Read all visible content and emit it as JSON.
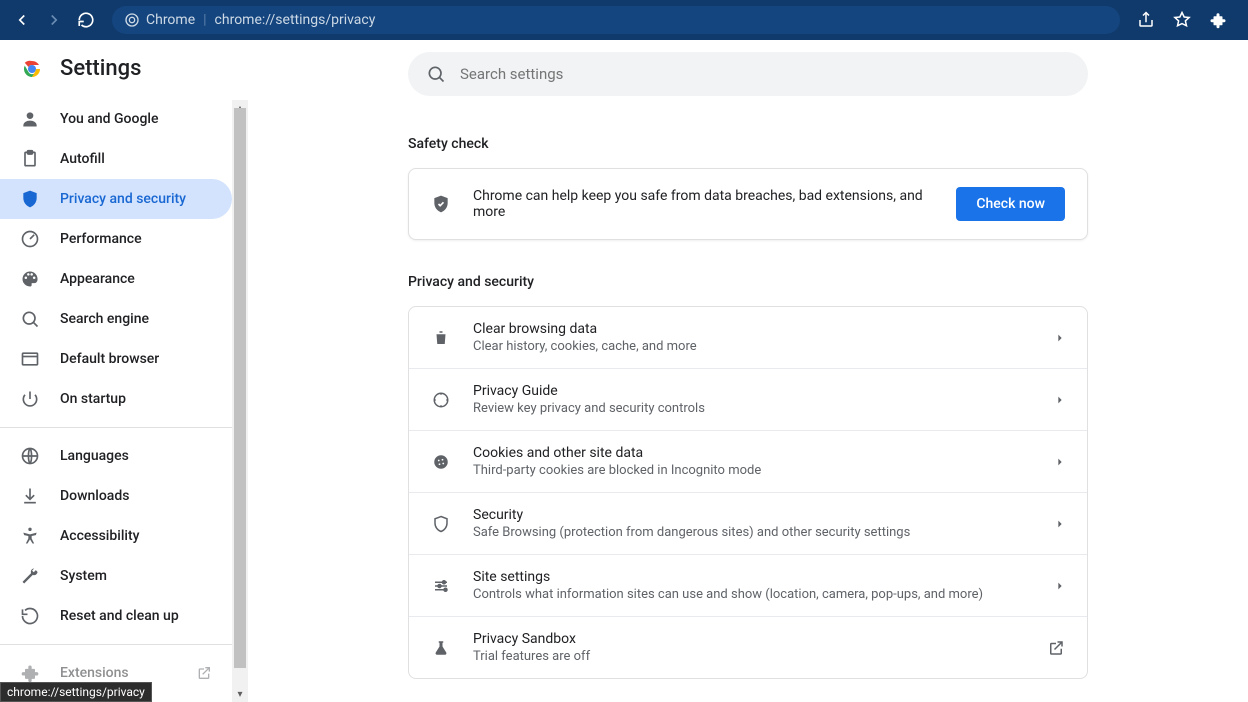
{
  "browser": {
    "url_label": "Chrome",
    "url_path": "chrome://settings/privacy"
  },
  "header": {
    "title": "Settings"
  },
  "search": {
    "placeholder": "Search settings"
  },
  "sidebar": {
    "items": [
      {
        "label": "You and Google"
      },
      {
        "label": "Autofill"
      },
      {
        "label": "Privacy and security"
      },
      {
        "label": "Performance"
      },
      {
        "label": "Appearance"
      },
      {
        "label": "Search engine"
      },
      {
        "label": "Default browser"
      },
      {
        "label": "On startup"
      }
    ],
    "items2": [
      {
        "label": "Languages"
      },
      {
        "label": "Downloads"
      },
      {
        "label": "Accessibility"
      },
      {
        "label": "System"
      },
      {
        "label": "Reset and clean up"
      }
    ],
    "extensions_label": "Extensions"
  },
  "safety": {
    "section_title": "Safety check",
    "text": "Chrome can help keep you safe from data breaches, bad extensions, and more",
    "button": "Check now"
  },
  "privacy": {
    "section_title": "Privacy and security",
    "rows": [
      {
        "title": "Clear browsing data",
        "sub": "Clear history, cookies, cache, and more"
      },
      {
        "title": "Privacy Guide",
        "sub": "Review key privacy and security controls"
      },
      {
        "title": "Cookies and other site data",
        "sub": "Third-party cookies are blocked in Incognito mode"
      },
      {
        "title": "Security",
        "sub": "Safe Browsing (protection from dangerous sites) and other security settings"
      },
      {
        "title": "Site settings",
        "sub": "Controls what information sites can use and show (location, camera, pop-ups, and more)"
      },
      {
        "title": "Privacy Sandbox",
        "sub": "Trial features are off"
      }
    ]
  },
  "status_tip": "chrome://settings/privacy"
}
